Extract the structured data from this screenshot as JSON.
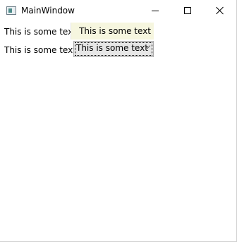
{
  "window": {
    "title": "MainWindow"
  },
  "icons": {
    "app": "app-window-icon",
    "minimize": "minimize-icon",
    "maximize": "maximize-icon",
    "close": "close-icon",
    "dropdown": "chevron-down-icon"
  },
  "form": {
    "row1_label": "This is some text",
    "row1_textbox_value": "This is some text",
    "row2_label": "This is some text",
    "row2_combo_selected": "This is some text"
  },
  "colors": {
    "textbox_background": "#f6f6df",
    "combo_background": "#e6e6e6"
  }
}
